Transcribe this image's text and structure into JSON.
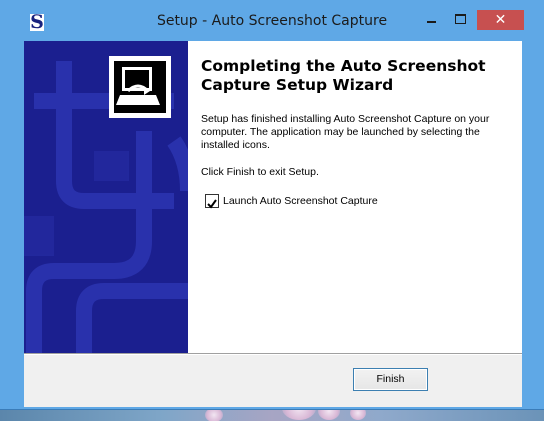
{
  "window": {
    "title": "Setup - Auto Screenshot Capture",
    "app_icon_letter": "S",
    "controls": {
      "minimize": "minimize",
      "maximize": "maximize",
      "close": "✕"
    }
  },
  "banner": {
    "background_color": "#1b1f8f",
    "icon": "computer-installer-icon"
  },
  "content": {
    "heading": "Completing the Auto Screenshot Capture Setup Wizard",
    "paragraph1": "Setup has finished installing Auto Screenshot Capture on your computer. The application may be launched by selecting the installed icons.",
    "paragraph2": "Click Finish to exit Setup.",
    "launch_checkbox": {
      "label": "Launch Auto Screenshot Capture",
      "checked": true
    }
  },
  "footer": {
    "finish_label": "Finish"
  },
  "colors": {
    "titlebar": "#5fa8e6",
    "close_button": "#c75050",
    "accent_border": "#3c7fb1"
  }
}
